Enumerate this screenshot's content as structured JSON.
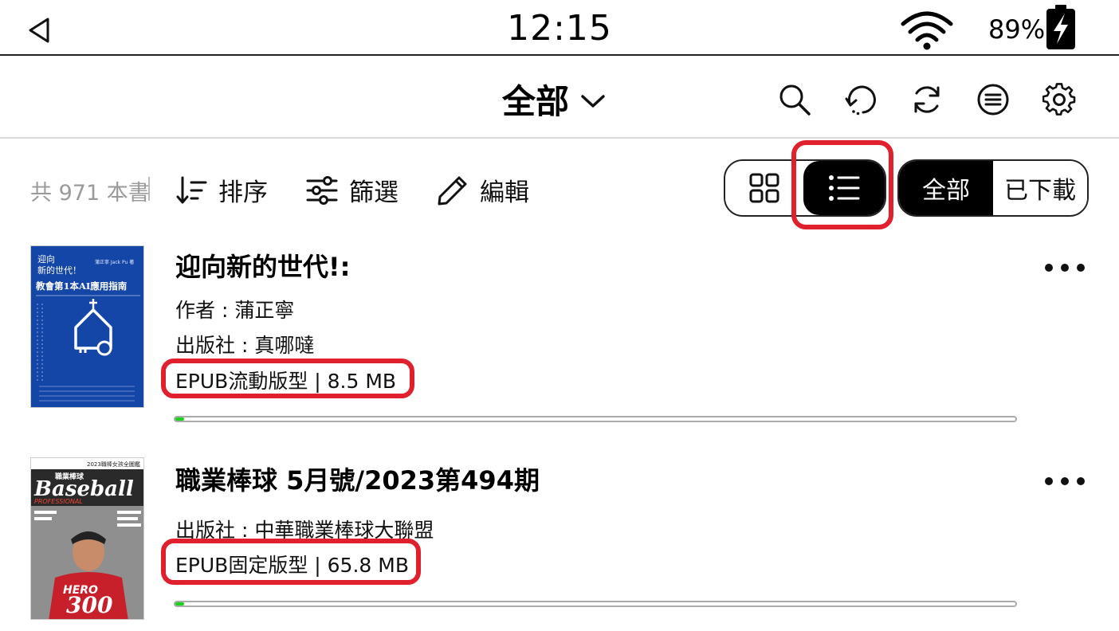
{
  "status": {
    "time": "12:15",
    "battery_percent": "89%",
    "icons": [
      "back-triangle-icon",
      "wifi-icon",
      "battery-charging-icon"
    ]
  },
  "header": {
    "category_label": "全部",
    "icons": [
      "chevron-down-icon",
      "search-icon",
      "sync-history-icon",
      "refresh-icon",
      "menu-list-icon",
      "gear-icon"
    ]
  },
  "toolbar": {
    "book_count": "共 971 本書",
    "sort_label": "排序",
    "filter_label": "篩選",
    "edit_label": "編輯",
    "view_modes": {
      "selected": "list"
    },
    "download_filter": {
      "all_label": "全部",
      "downloaded_label": "已下載",
      "selected": "all"
    }
  },
  "books": [
    {
      "title": "迎向新的世代!:",
      "author": "作者 : 蒲正寧",
      "publisher": "出版社 : 真哪噠",
      "format": "EPUB流動版型 | 8.5 MB",
      "progress": 0.01,
      "cover": {
        "line1": "迎向",
        "line2": "新的世代！",
        "author": "蒲正寧 Jack Pu 著",
        "headline": "教會第1本AI應用指南",
        "bg_color": "#1446a8"
      }
    },
    {
      "title": "職業棒球 5月號/2023第494期",
      "publisher": "出版社 : 中華職業棒球大聯盟",
      "format": "EPUB固定版型 | 65.8 MB",
      "progress": 0.01,
      "cover": {
        "brand": "Baseball",
        "brand_sub": "PROFESSIONAL",
        "banner": "2023職棒女孩全圖鑑",
        "tag": "職業棒球",
        "big_text": "300",
        "bg_color": "#b51d24"
      }
    }
  ],
  "colors": {
    "highlight": "#e0202c",
    "progress": "#1fd11f",
    "selected_bg": "#000000"
  }
}
